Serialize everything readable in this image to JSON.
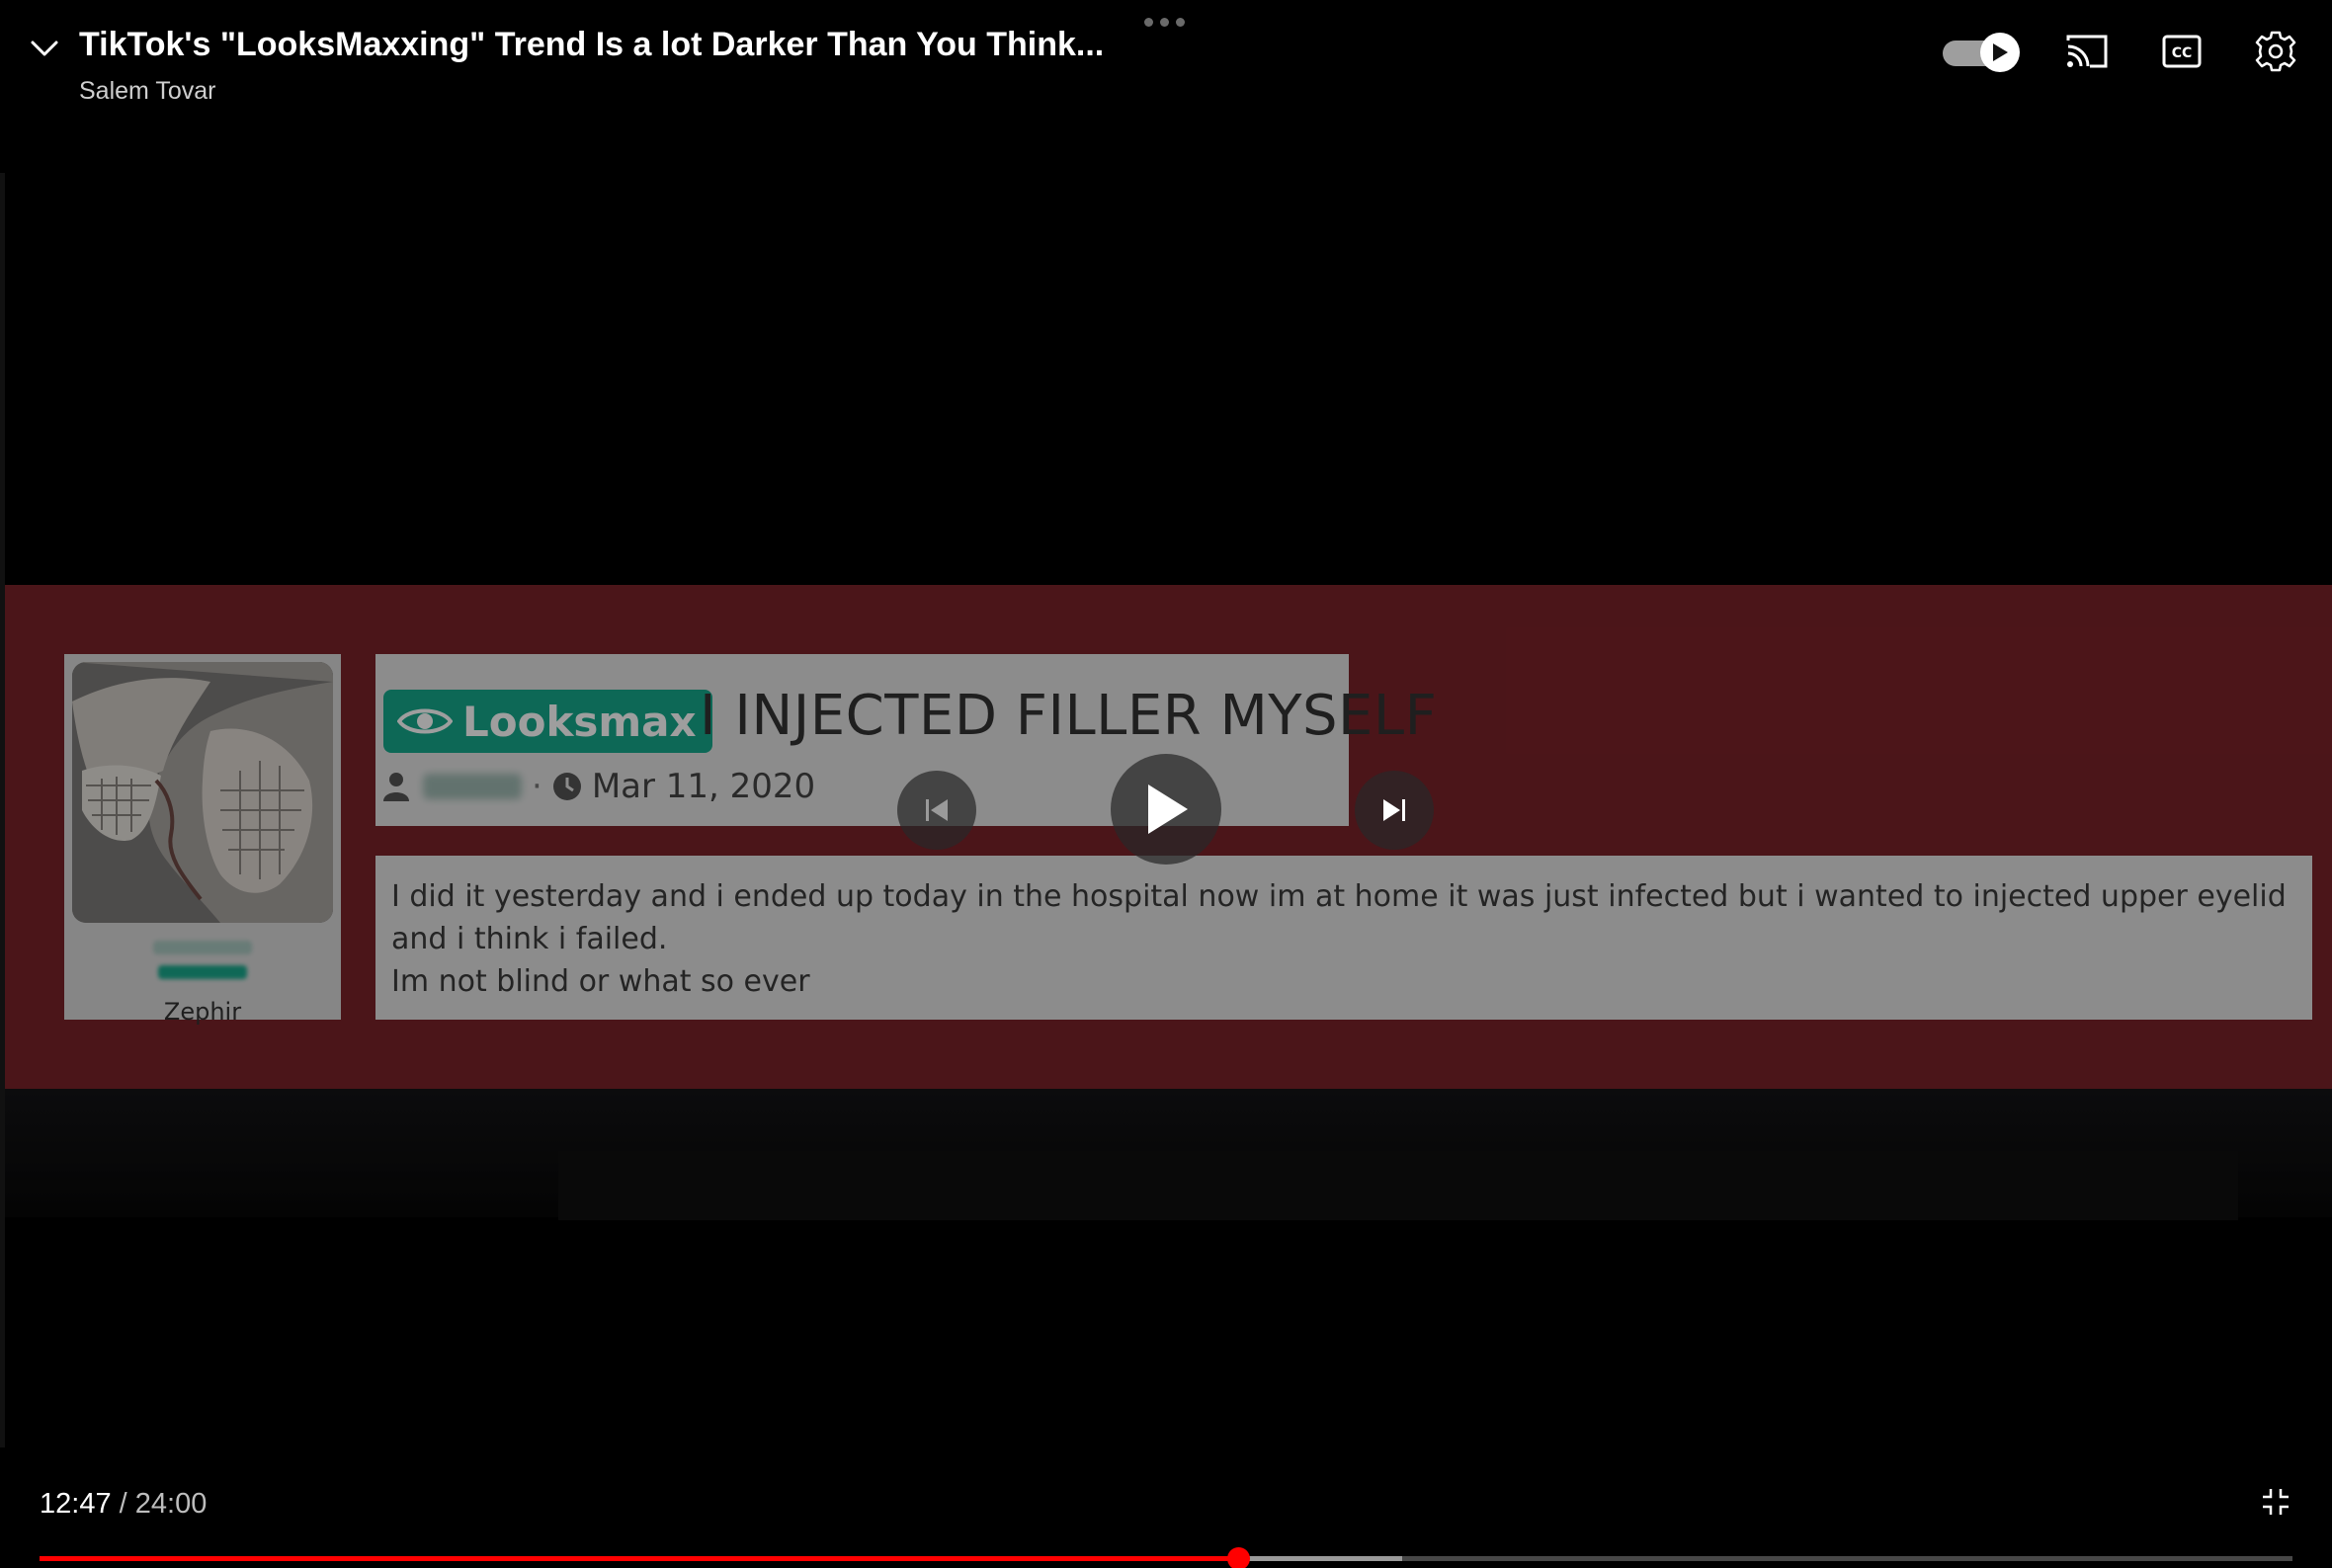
{
  "header": {
    "video_title": "TikTok's \"LooksMaxxing\" Trend Is a lot Darker Than You Think...",
    "channel_name": "Salem Tovar"
  },
  "controls": {
    "autoplay_on": true,
    "collapse_icon": "chevron-down-icon",
    "cast_icon": "cast-icon",
    "captions_icon": "cc-icon",
    "settings_icon": "gear-icon",
    "previous_icon": "skip-previous-icon",
    "play_icon": "play-icon",
    "next_icon": "skip-next-icon",
    "exit_fullscreen_icon": "exit-fullscreen-icon"
  },
  "playback": {
    "current_time": "12:47",
    "separator": " / ",
    "duration": "24:00",
    "played_fraction": 0.532,
    "buffered_fraction": 0.605
  },
  "video_frame": {
    "forum_badge": "Looksmax",
    "thread_title": "I INJECTED FILLER MYSELF",
    "thread_date": "Mar 11, 2020",
    "post_username": "Zephir",
    "post_lines": [
      "I did it yesterday and i ended up today in the hospital now im at home it was just infected but i wanted to injected upper eyelid and i think i failed.",
      "Im not blind or what so ever"
    ]
  },
  "colors": {
    "band_red": "#7a2229",
    "badge_green": "#15a88c",
    "progress_red": "#ff0000"
  }
}
